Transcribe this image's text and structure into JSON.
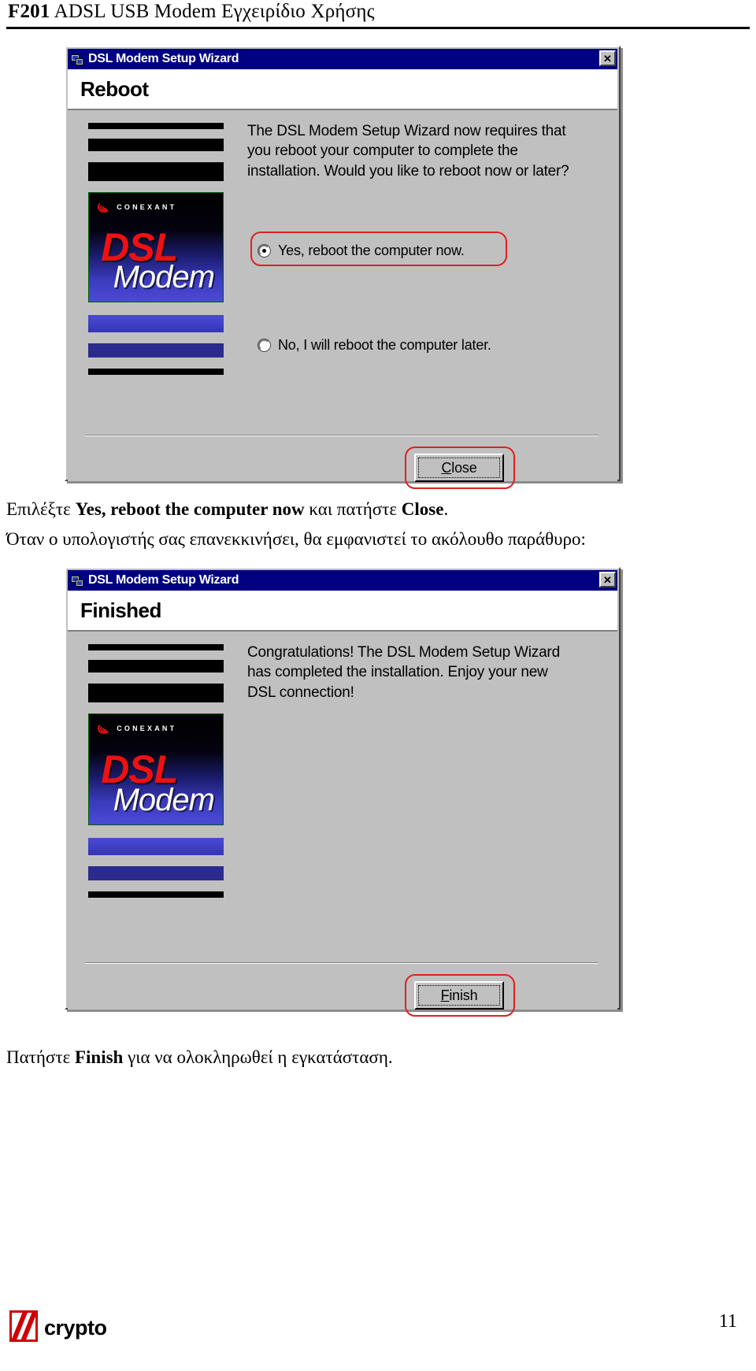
{
  "document": {
    "header_bold": "F201",
    "header_rest": " ADSL USB Modem Εγχειρίδιο Χρήσης",
    "page_number": "11",
    "footer_brand": "crypto"
  },
  "dialog_reboot": {
    "title": "DSL Modem Setup Wizard",
    "close_box_label": "✕",
    "step_heading": "Reboot",
    "body_text": "The DSL Modem Setup Wizard now requires that you reboot your computer to complete the installation.  Would you like to reboot now or later?",
    "options": [
      {
        "label": "Yes, reboot the computer now.",
        "selected": true
      },
      {
        "label": "No, I will reboot the computer later.",
        "selected": false
      }
    ],
    "button_label_pre": "",
    "button_accel": "C",
    "button_label_post": "lose",
    "banner": {
      "brand_mark": "CONEXANT",
      "product_line1": "DSL",
      "product_line2": "Modem"
    }
  },
  "caption_1": {
    "part1": "Επιλέξτε ",
    "bold1": "Yes, reboot the computer now",
    "part2": " και πατήστε ",
    "bold2": "Close",
    "part3": ".",
    "line2": "Όταν ο υπολογιστής σας επανεκκινήσει, θα εμφανιστεί το ακόλουθο παράθυρο:"
  },
  "dialog_finished": {
    "title": "DSL Modem Setup Wizard",
    "close_box_label": "✕",
    "step_heading": "Finished",
    "body_text": "Congratulations!  The DSL Modem Setup Wizard has completed the installation.  Enjoy your new DSL connection!",
    "button_accel": "F",
    "button_label_post": "inish",
    "banner": {
      "brand_mark": "CONEXANT",
      "product_line1": "DSL",
      "product_line2": "Modem"
    }
  },
  "caption_2": {
    "part1": "Πατήστε ",
    "bold1": "Finish",
    "part2": " για να ολοκληρωθεί η εγκατάσταση."
  },
  "colors": {
    "titlebar": "#000080",
    "dialog_face": "#c0c0c0",
    "annotation": "#e02020",
    "logo_red": "#ee1111",
    "brand_red": "#d00000"
  }
}
